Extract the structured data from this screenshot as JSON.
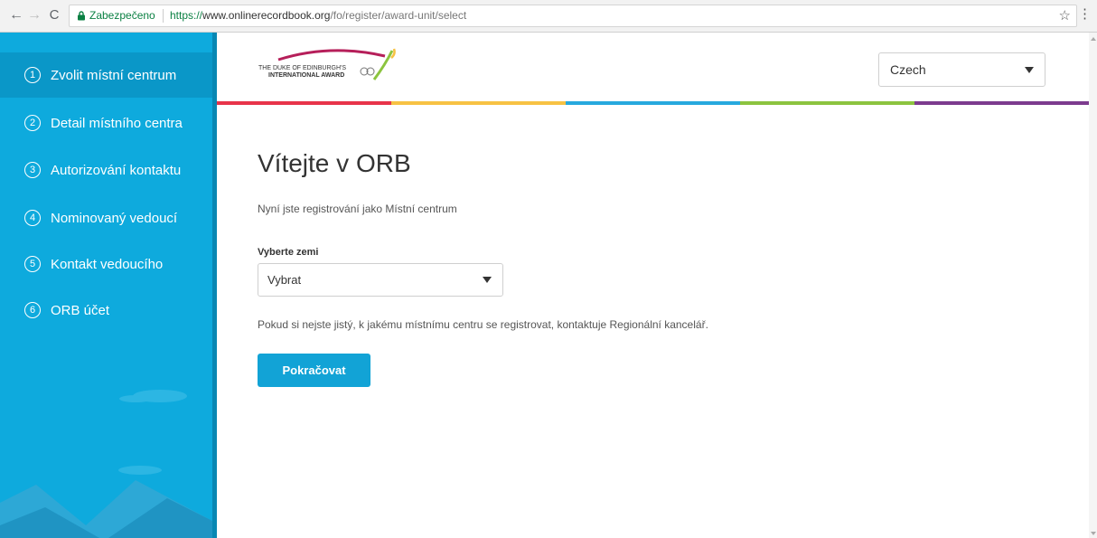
{
  "browser": {
    "secure_label": "Zabezpečeno",
    "url_scheme": "https://",
    "url_host": "www.onlinerecordbook.org",
    "url_path": "/fo/register/award-unit/select",
    "back_icon": "←",
    "forward_icon": "→",
    "reload_icon": "C",
    "star_icon": "☆",
    "menu_icon": "⋮"
  },
  "sidebar": {
    "steps": [
      {
        "num": "1",
        "label": "Zvolit místní centrum",
        "active": true
      },
      {
        "num": "2",
        "label": "Detail místního centra"
      },
      {
        "num": "3",
        "label": "Autorizování kontaktu"
      },
      {
        "num": "4",
        "label": "Nominovaný vedoucí"
      },
      {
        "num": "5",
        "label": "Kontakt vedoucího"
      },
      {
        "num": "6",
        "label": "ORB účet"
      }
    ]
  },
  "header": {
    "logo_line1": "THE DUKE OF EDINBURGH'S",
    "logo_line2": "INTERNATIONAL AWARD",
    "language": "Czech"
  },
  "colors": {
    "sidebar": "#0eaadd",
    "button": "#12a3d6",
    "bar": [
      "#e8334a",
      "#f7c244",
      "#27a9de",
      "#8cc43f",
      "#7c3b8e"
    ]
  },
  "main": {
    "title": "Vítejte v ORB",
    "subtitle": "Nyní jste registrování jako Místní centrum",
    "country_label": "Vyberte zemi",
    "country_value": "Vybrat",
    "help_text": "Pokud si nejste jistý, k jakému místnímu centru se registrovat, kontaktuje Regionální kancelář.",
    "continue_label": "Pokračovat"
  }
}
